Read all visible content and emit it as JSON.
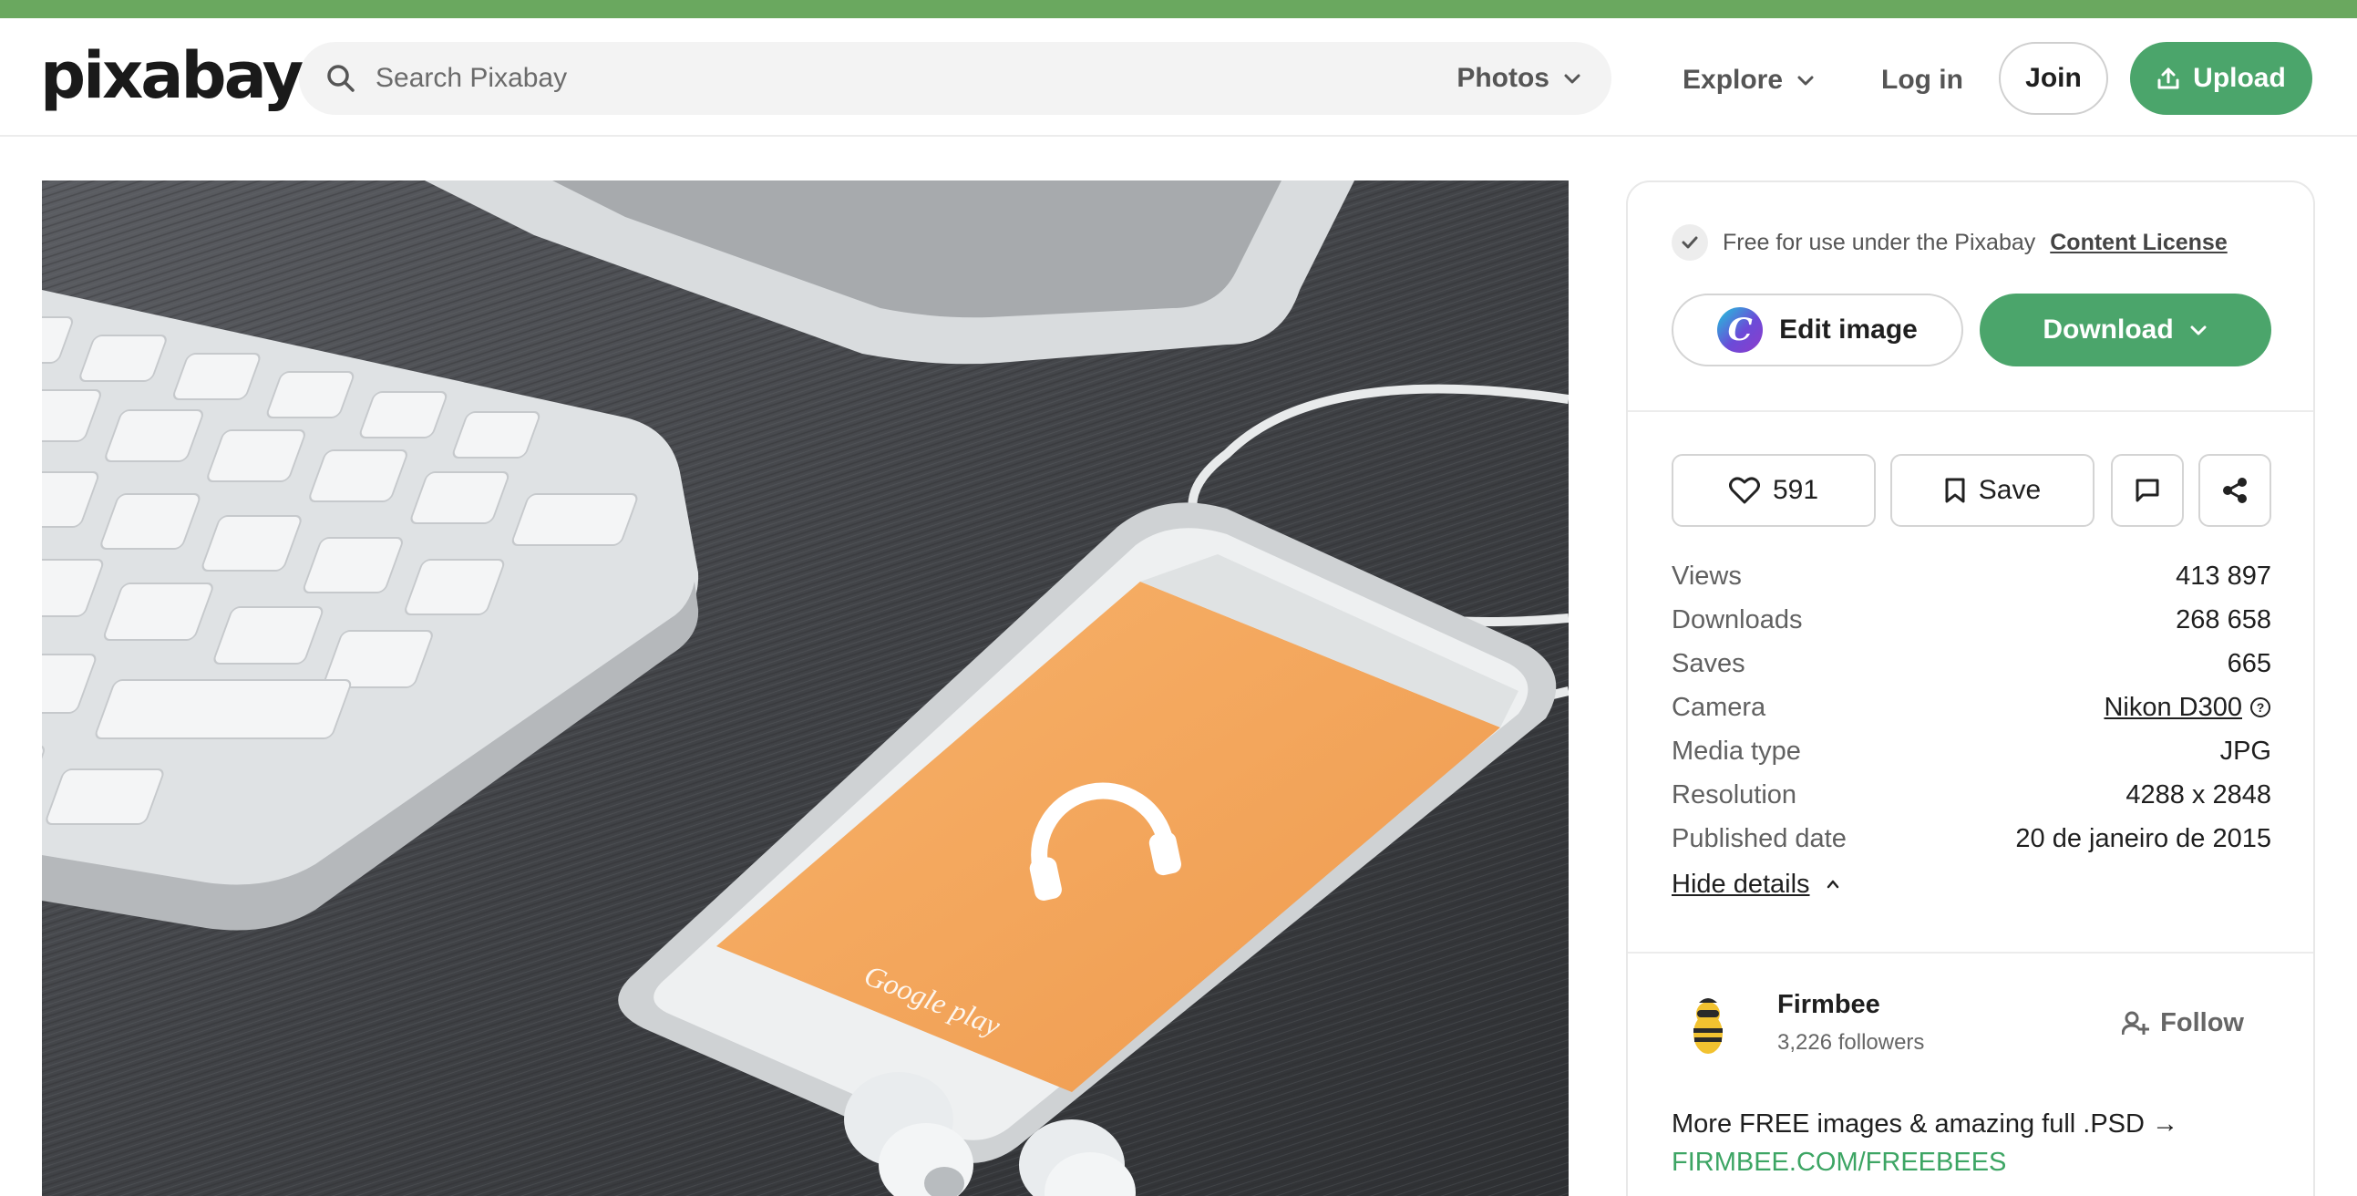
{
  "header": {
    "logo": "pixabay",
    "search_placeholder": "Search Pixabay",
    "search_type": "Photos",
    "explore_label": "Explore",
    "login_label": "Log in",
    "join_label": "Join",
    "upload_label": "Upload"
  },
  "photo": {
    "screen_text": "Google play"
  },
  "panel": {
    "license_text": "Free for use under the Pixabay",
    "license_link": "Content License",
    "edit_label": "Edit image",
    "download_label": "Download",
    "likes_count": "591",
    "save_label": "Save",
    "details": [
      {
        "label": "Views",
        "value": "413 897"
      },
      {
        "label": "Downloads",
        "value": "268 658"
      },
      {
        "label": "Saves",
        "value": "665"
      },
      {
        "label": "Camera",
        "value": "Nikon D300"
      },
      {
        "label": "Media type",
        "value": "JPG"
      },
      {
        "label": "Resolution",
        "value": "4288 x 2848"
      },
      {
        "label": "Published date",
        "value": "20 de janeiro de 2015"
      }
    ],
    "hide_details_label": "Hide details",
    "author": {
      "name": "Firmbee",
      "followers": "3,226 followers",
      "follow_label": "Follow"
    },
    "promo_text": "More FREE images & amazing full .PSD →",
    "promo_url": "FIRMBEE.COM/FREEBEES"
  },
  "colors": {
    "brand_green": "#4ba56b",
    "top_bar": "#6aa85f",
    "screen_orange": "#f4a45a"
  }
}
